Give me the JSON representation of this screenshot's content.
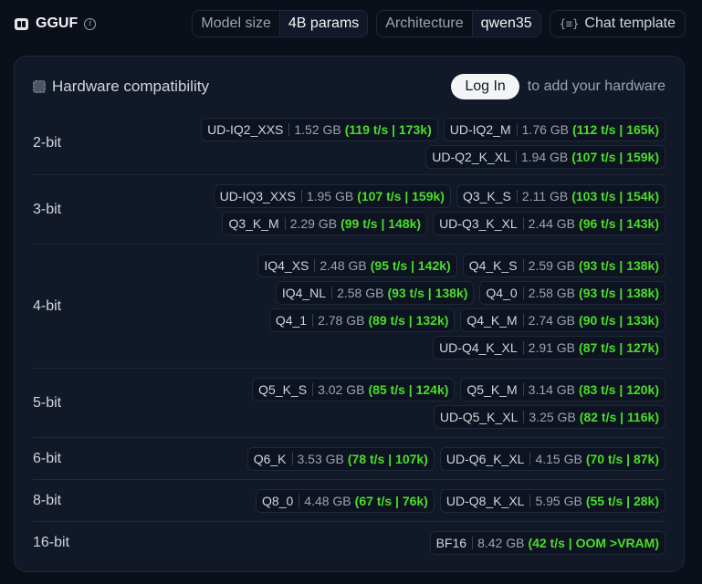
{
  "header": {
    "title": "GGUF",
    "icon": "gguf-icon",
    "model_size_label": "Model size",
    "model_size_value": "4B params",
    "architecture_label": "Architecture",
    "architecture_value": "qwen35",
    "chat_template_label": "Chat template"
  },
  "panel": {
    "title": "Hardware compatibility",
    "login_label": "Log In",
    "login_suffix": "to add your hardware"
  },
  "colors": {
    "perf": "#4ade2a",
    "background": "#0b0f19",
    "panel": "#111827"
  },
  "rows": [
    {
      "label": "2-bit",
      "quants": [
        {
          "name": "UD-IQ2_XXS",
          "size": "1.52 GB",
          "perf": "(119 t/s | 173k)"
        },
        {
          "name": "UD-IQ2_M",
          "size": "1.76 GB",
          "perf": "(112 t/s | 165k)"
        },
        {
          "name": "UD-Q2_K_XL",
          "size": "1.94 GB",
          "perf": "(107 t/s | 159k)"
        }
      ]
    },
    {
      "label": "3-bit",
      "quants": [
        {
          "name": "UD-IQ3_XXS",
          "size": "1.95 GB",
          "perf": "(107 t/s | 159k)"
        },
        {
          "name": "Q3_K_S",
          "size": "2.11 GB",
          "perf": "(103 t/s | 154k)"
        },
        {
          "name": "Q3_K_M",
          "size": "2.29 GB",
          "perf": "(99 t/s | 148k)"
        },
        {
          "name": "UD-Q3_K_XL",
          "size": "2.44 GB",
          "perf": "(96 t/s | 143k)"
        }
      ]
    },
    {
      "label": "4-bit",
      "quants": [
        {
          "name": "IQ4_XS",
          "size": "2.48 GB",
          "perf": "(95 t/s | 142k)"
        },
        {
          "name": "Q4_K_S",
          "size": "2.59 GB",
          "perf": "(93 t/s | 138k)"
        },
        {
          "name": "IQ4_NL",
          "size": "2.58 GB",
          "perf": "(93 t/s | 138k)"
        },
        {
          "name": "Q4_0",
          "size": "2.58 GB",
          "perf": "(93 t/s | 138k)"
        },
        {
          "name": "Q4_1",
          "size": "2.78 GB",
          "perf": "(89 t/s | 132k)"
        },
        {
          "name": "Q4_K_M",
          "size": "2.74 GB",
          "perf": "(90 t/s | 133k)"
        },
        {
          "name": "UD-Q4_K_XL",
          "size": "2.91 GB",
          "perf": "(87 t/s | 127k)"
        }
      ]
    },
    {
      "label": "5-bit",
      "quants": [
        {
          "name": "Q5_K_S",
          "size": "3.02 GB",
          "perf": "(85 t/s | 124k)"
        },
        {
          "name": "Q5_K_M",
          "size": "3.14 GB",
          "perf": "(83 t/s | 120k)"
        },
        {
          "name": "UD-Q5_K_XL",
          "size": "3.25 GB",
          "perf": "(82 t/s | 116k)"
        }
      ]
    },
    {
      "label": "6-bit",
      "quants": [
        {
          "name": "Q6_K",
          "size": "3.53 GB",
          "perf": "(78 t/s | 107k)"
        },
        {
          "name": "UD-Q6_K_XL",
          "size": "4.15 GB",
          "perf": "(70 t/s | 87k)"
        }
      ]
    },
    {
      "label": "8-bit",
      "quants": [
        {
          "name": "Q8_0",
          "size": "4.48 GB",
          "perf": "(67 t/s | 76k)"
        },
        {
          "name": "UD-Q8_K_XL",
          "size": "5.95 GB",
          "perf": "(55 t/s | 28k)"
        }
      ]
    },
    {
      "label": "16-bit",
      "quants": [
        {
          "name": "BF16",
          "size": "8.42 GB",
          "perf": "(42 t/s | OOM >VRAM)"
        }
      ]
    }
  ]
}
